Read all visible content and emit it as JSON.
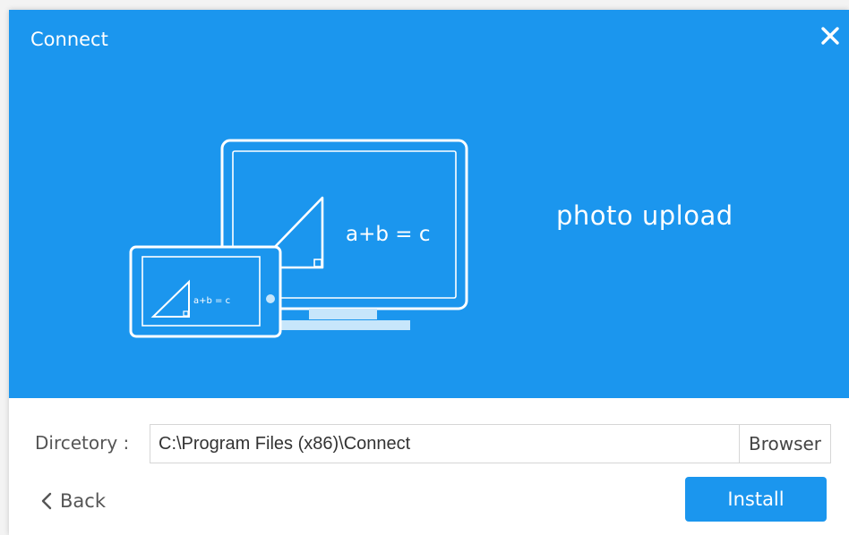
{
  "window": {
    "title": "Connect",
    "close_icon": "close-icon",
    "accent_color": "#1b96ee"
  },
  "hero": {
    "tagline": "photo upload",
    "monitor_formula": "a+b = c",
    "tablet_formula": "a+b = c",
    "icons": [
      "monitor-icon",
      "tablet-icon"
    ]
  },
  "directory": {
    "label": "Dircetory :",
    "value": "C:\\Program Files (x86)\\Connect",
    "browse_label": "Browser"
  },
  "footer": {
    "back_label": "Back",
    "back_icon": "chevron-left-icon",
    "install_label": "Install"
  }
}
